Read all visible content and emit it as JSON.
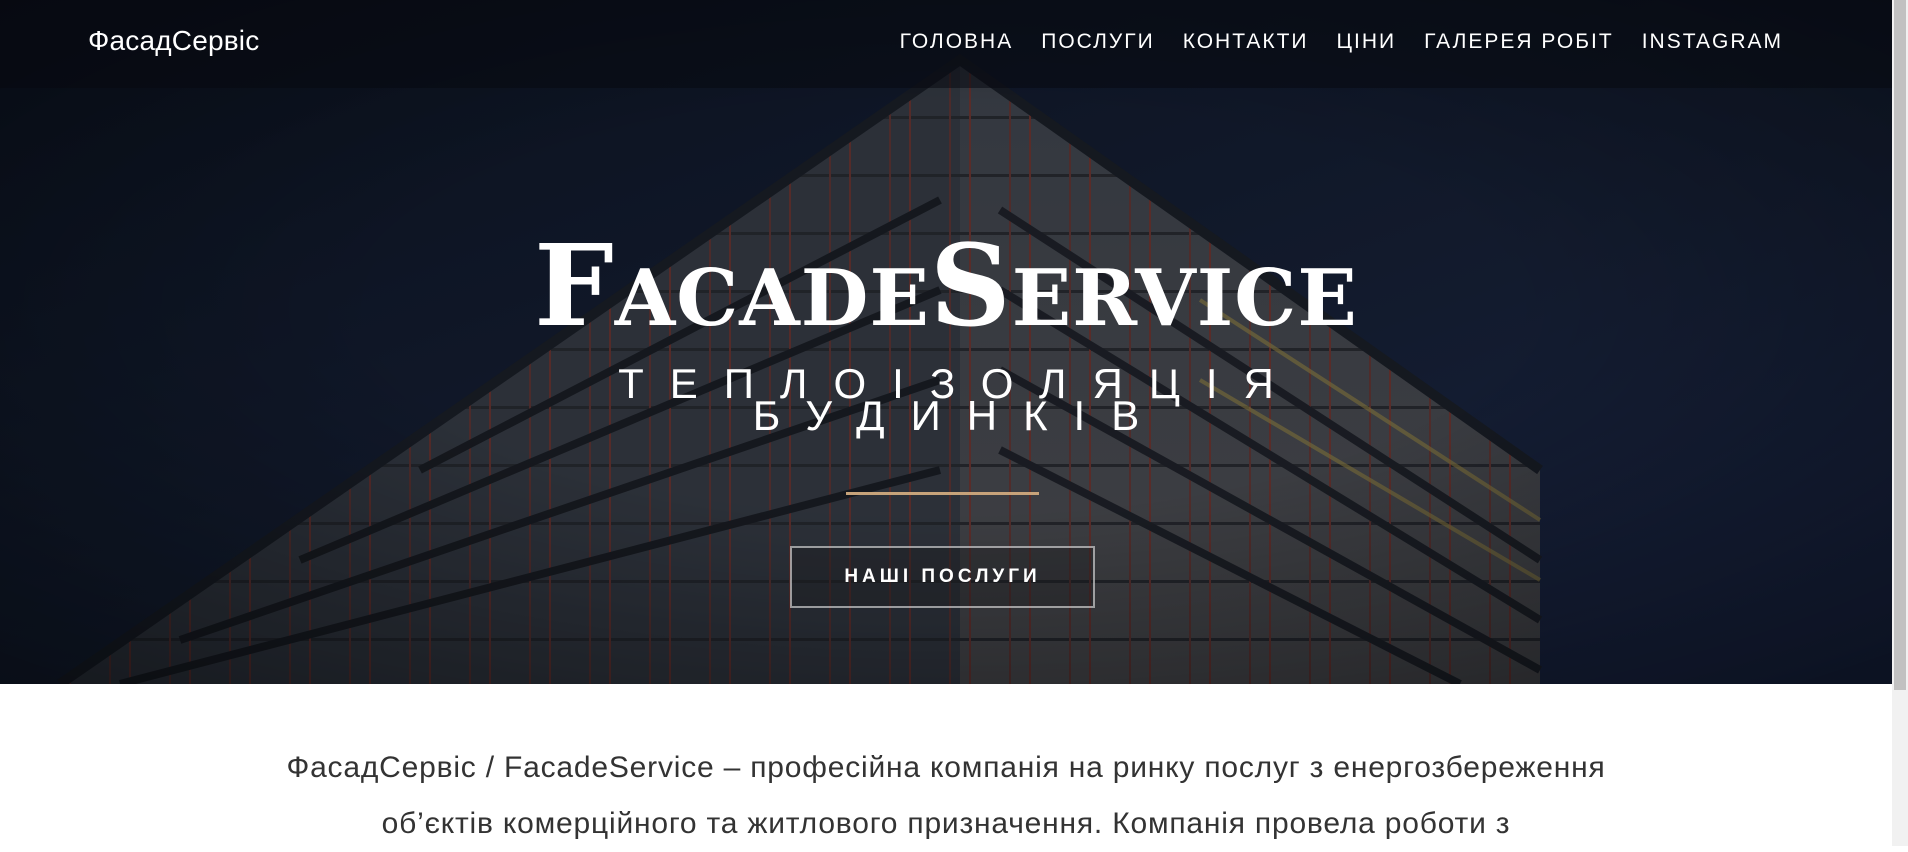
{
  "brand": {
    "name": "ФасадСервіс"
  },
  "nav": {
    "items": [
      {
        "label": "ГОЛОВНА"
      },
      {
        "label": "ПОСЛУГИ"
      },
      {
        "label": "КОНТАКТИ"
      },
      {
        "label": "ЦІНИ"
      },
      {
        "label": "ГАЛЕРЕЯ РОБІТ"
      },
      {
        "label": "INSTAGRAM"
      }
    ]
  },
  "hero": {
    "title": "FacadeService",
    "subtitle_line1": "ТЕПЛОІЗОЛЯЦІЯ",
    "subtitle_line2": "БУДИНКІВ",
    "button_label": "НАШІ ПОСЛУГИ",
    "background_image": "building-scaffolding-photo"
  },
  "about": {
    "line1": "ФасадСервіс / FacadeService – професійна компанія на ринку послуг з енергозбереження",
    "line2": "об’єктів комерційного та житлового призначення. Компанія провела роботи з"
  },
  "colors": {
    "hero_overlay": "#0f1628",
    "accent_rule": "#c7a37a",
    "text_light": "#ffffff",
    "text_body": "#333333"
  }
}
